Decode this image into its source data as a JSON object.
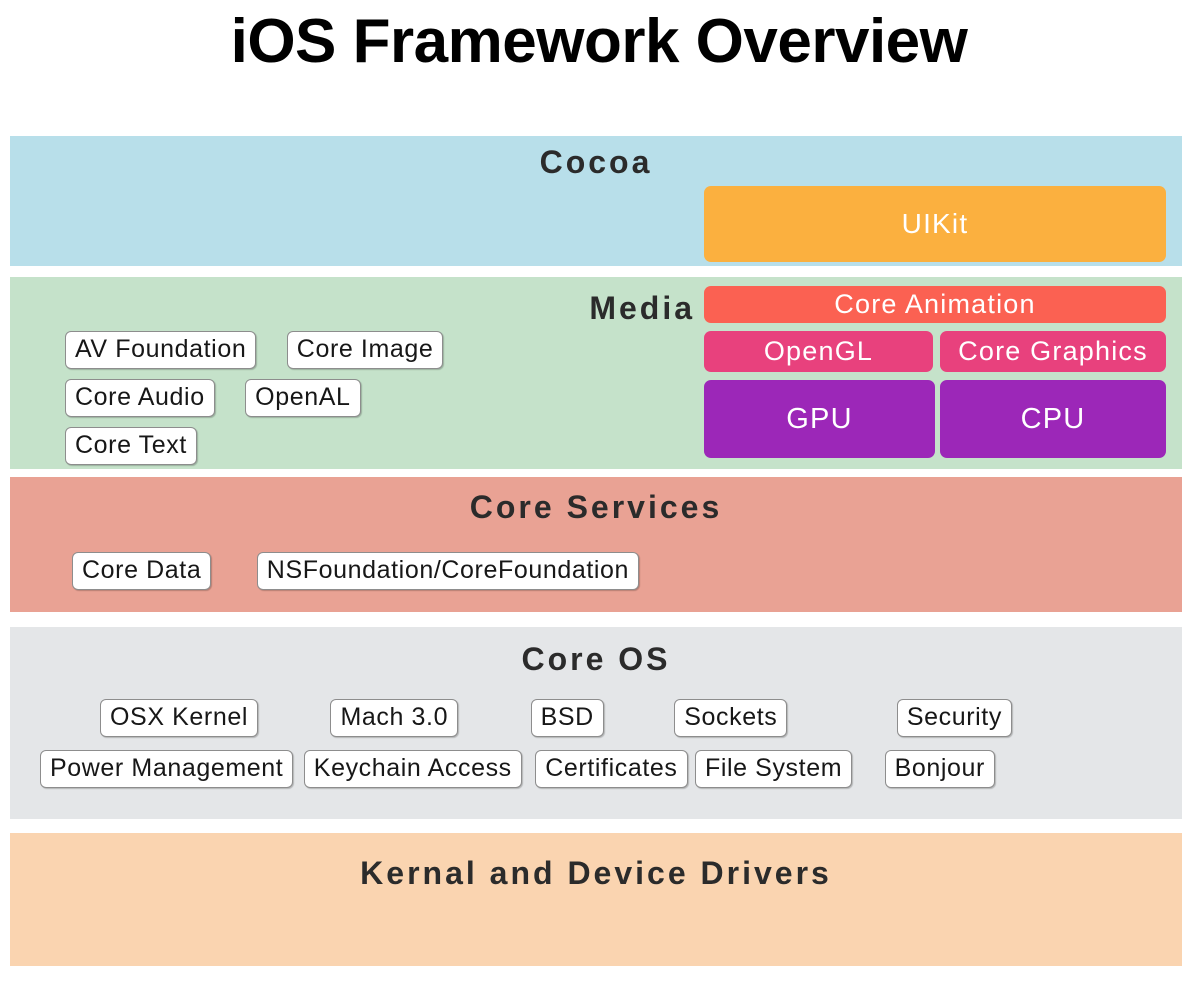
{
  "page": {
    "title": "iOS Framework Overview"
  },
  "colors": {
    "cocoa_band": "#b8dfea",
    "media_band": "#c5e2ca",
    "core_services_band": "#e9a294",
    "core_os_band": "#e4e6e8",
    "kernel_band": "#fad4b0",
    "uikit": "#fbb03f",
    "core_animation": "#fb6152",
    "graphics_api": "#e8417d",
    "processor": "#9c27b8"
  },
  "layers": {
    "cocoa": {
      "title": "Cocoa",
      "blocks": [
        {
          "label": "UIKit"
        }
      ]
    },
    "media": {
      "title": "Media",
      "chips": [
        [
          "AV Foundation",
          "Core Image"
        ],
        [
          "Core Audio",
          "OpenAL"
        ],
        [
          "Core Text"
        ]
      ],
      "blocks": [
        {
          "label": "Core Animation"
        },
        {
          "label": "OpenGL"
        },
        {
          "label": "Core Graphics"
        },
        {
          "label": "GPU"
        },
        {
          "label": "CPU"
        }
      ]
    },
    "core_services": {
      "title": "Core Services",
      "chips": [
        [
          "Core Data",
          "NSFoundation/CoreFoundation"
        ]
      ]
    },
    "core_os": {
      "title": "Core OS",
      "chips": [
        [
          "OSX Kernel",
          "Mach 3.0",
          "BSD",
          "Sockets",
          "Security"
        ],
        [
          "Power Management",
          "Keychain Access",
          "Certificates",
          "File System",
          "Bonjour"
        ]
      ]
    },
    "kernel": {
      "title": "Kernal and Device Drivers"
    }
  }
}
